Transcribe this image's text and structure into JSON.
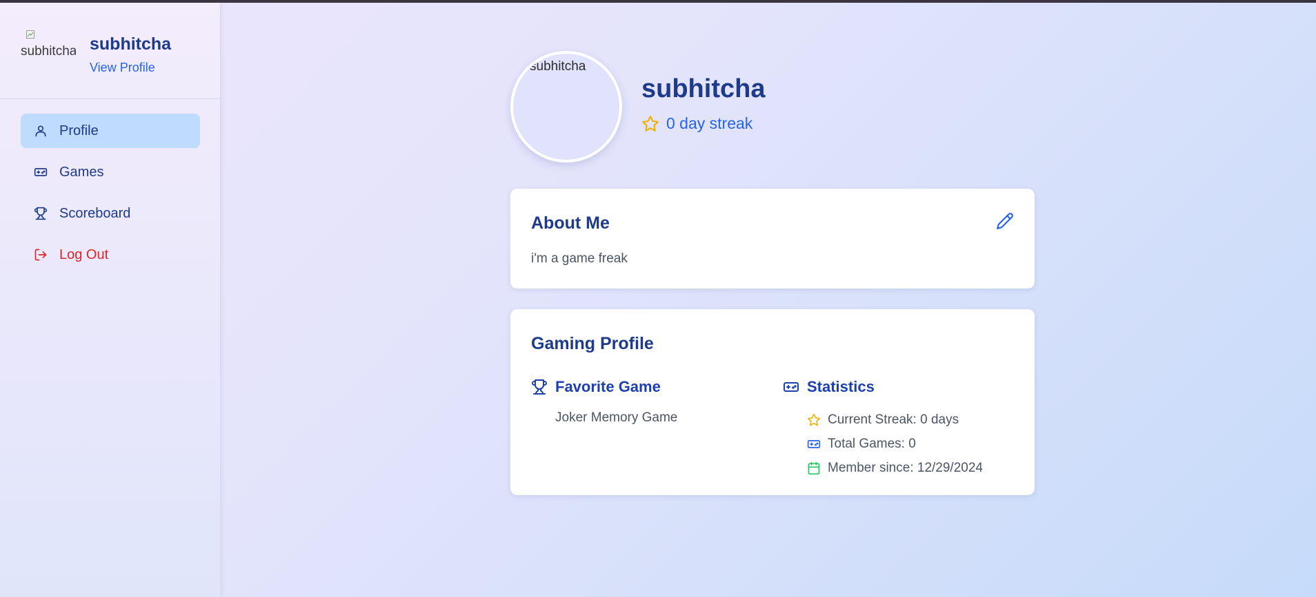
{
  "colors": {
    "primary_text": "#1e3a8a",
    "link": "#2563eb",
    "active_nav_bg": "#bfdbfe",
    "logout": "#dc2626",
    "streak_star": "#eab308",
    "calendar": "#22c55e"
  },
  "sidebar": {
    "avatar_alt": "subhitcha",
    "username": "subhitcha",
    "view_profile": "View Profile",
    "items": [
      {
        "label": "Profile",
        "icon": "user-icon",
        "active": true
      },
      {
        "label": "Games",
        "icon": "gamepad-icon",
        "active": false
      },
      {
        "label": "Scoreboard",
        "icon": "trophy-icon",
        "active": false
      },
      {
        "label": "Log Out",
        "icon": "logout-icon",
        "active": false
      }
    ]
  },
  "profile": {
    "avatar_alt": "subhitcha",
    "username": "subhitcha",
    "streak": "0 day streak"
  },
  "about": {
    "title": "About Me",
    "text": "i'm a game freak",
    "edit_icon": "pencil-icon"
  },
  "gaming": {
    "title": "Gaming Profile",
    "favorite": {
      "heading": "Favorite Game",
      "value": "Joker Memory Game"
    },
    "statistics": {
      "heading": "Statistics",
      "items": [
        {
          "label": "Current Streak: 0 days",
          "icon": "star-icon"
        },
        {
          "label": "Total Games: 0",
          "icon": "gamepad-icon"
        },
        {
          "label": "Member since: 12/29/2024",
          "icon": "calendar-icon"
        }
      ]
    }
  }
}
